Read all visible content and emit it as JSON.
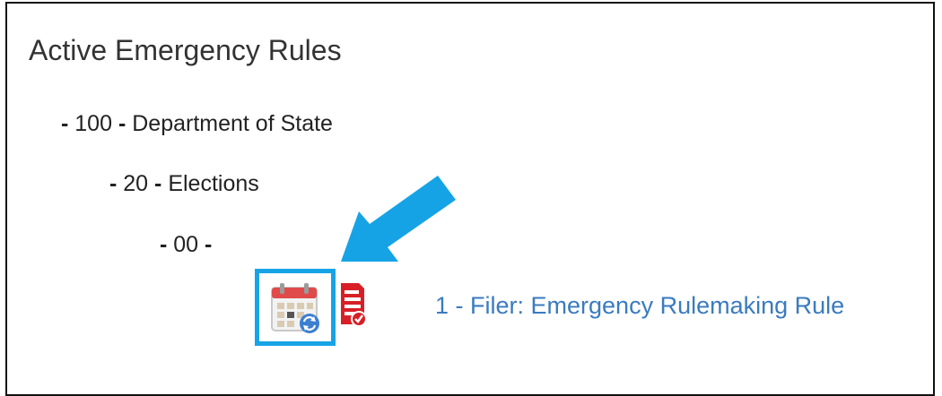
{
  "page": {
    "title": "Active Emergency Rules"
  },
  "tree": {
    "department": {
      "dash": "-",
      "number": "100",
      "sep": "-",
      "name": "Department of State"
    },
    "division": {
      "dash": "-",
      "number": "20",
      "sep": "-",
      "name": "Elections"
    },
    "chapter": {
      "dash": "-",
      "number": "00",
      "sep": "-",
      "name": ""
    }
  },
  "rule": {
    "link_text": "1 - Filer: Emergency Rulemaking Rule"
  },
  "icons": {
    "schedule": "calendar-refresh-icon",
    "report": "report-checked-icon",
    "annotation": "arrow-pointer"
  },
  "colors": {
    "link": "#3a7bbf",
    "highlight": "#17a4e6",
    "arrow": "#16a3e6",
    "calendar_red": "#e04a4a",
    "report_red": "#d81f26"
  }
}
